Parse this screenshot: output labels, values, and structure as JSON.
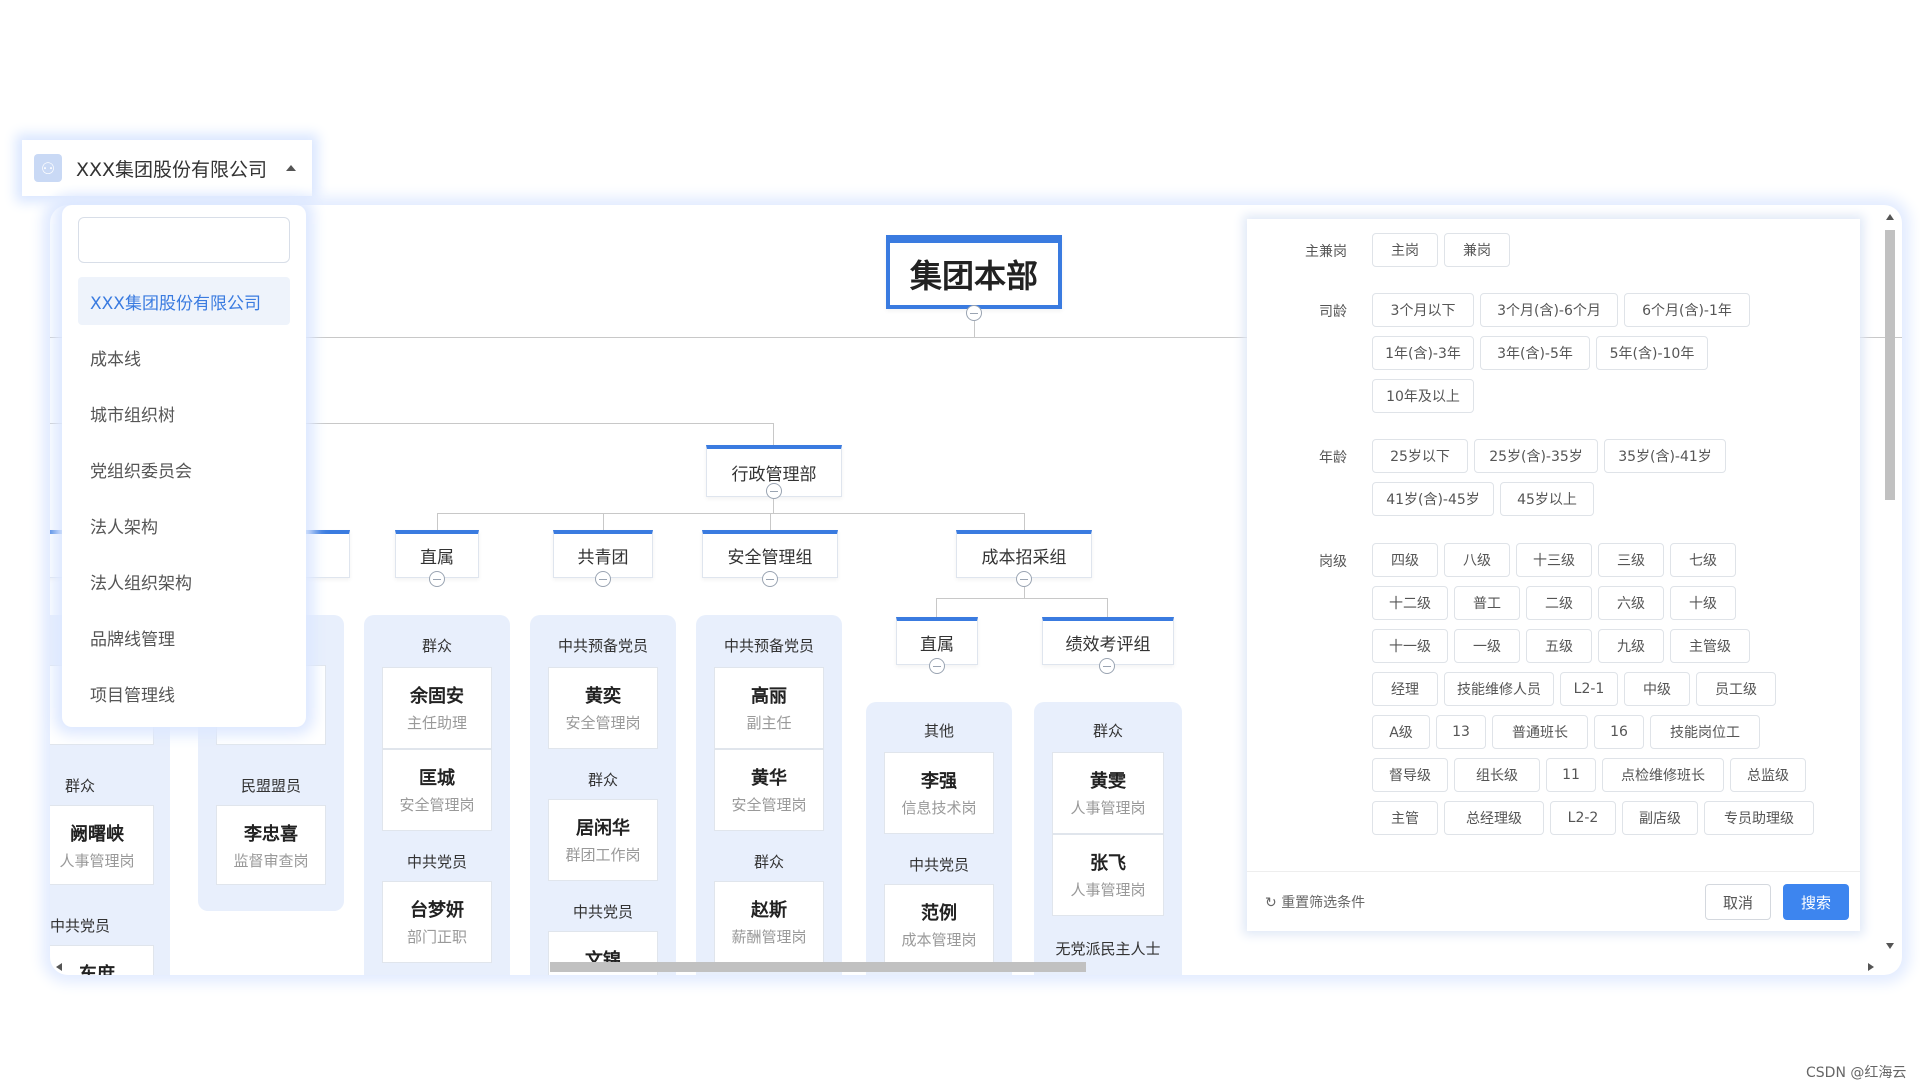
{
  "org_selector": {
    "icon": "org-tree-icon",
    "label": "XXX集团股份有限公司"
  },
  "dropdown": {
    "options": [
      "XXX集团股份有限公司",
      "成本线",
      "城市组织树",
      "党组织委员会",
      "法人架构",
      "法人组织架构",
      "品牌线管理",
      "项目管理线"
    ]
  },
  "tree": {
    "root": "集团本部",
    "level1": "行政管理部",
    "level2": [
      "直属",
      "共青团",
      "安全管理组",
      "成本招采组"
    ],
    "level3": [
      "直属",
      "绩效考评组"
    ],
    "columns": {
      "far_left": {
        "groups": [
          "群众",
          "中共党员"
        ],
        "cards": [
          {
            "name": "阙曙峡",
            "role": "人事管理岗"
          },
          {
            "name": "东庶",
            "role": ""
          }
        ]
      },
      "left2": {
        "groups": [
          "民盟盟员"
        ],
        "cards": [
          {
            "name": "李忠喜",
            "role": "监督审查岗"
          }
        ]
      },
      "zhishu": {
        "groups": [
          "群众",
          "中共党员"
        ],
        "cards": [
          {
            "name": "余固安",
            "role": "主任助理"
          },
          {
            "name": "匡城",
            "role": "安全管理岗"
          },
          {
            "name": "台梦妍",
            "role": "部门正职"
          }
        ]
      },
      "gongqingtuan": {
        "groups": [
          "中共预备党员",
          "群众",
          "中共党员"
        ],
        "cards": [
          {
            "name": "黄奕",
            "role": "安全管理岗"
          },
          {
            "name": "居闲华",
            "role": "群团工作岗"
          },
          {
            "name": "文锦",
            "role": ""
          }
        ]
      },
      "anquan": {
        "groups": [
          "中共预备党员",
          "群众"
        ],
        "cards": [
          {
            "name": "高丽",
            "role": "副主任"
          },
          {
            "name": "黄华",
            "role": "安全管理岗"
          },
          {
            "name": "赵斯",
            "role": "薪酬管理岗"
          }
        ]
      },
      "zhishu2": {
        "groups": [
          "其他",
          "中共党员"
        ],
        "cards": [
          {
            "name": "李强",
            "role": "信息技术岗"
          },
          {
            "name": "范例",
            "role": "成本管理岗"
          }
        ]
      },
      "jixiao": {
        "groups": [
          "群众",
          "无党派民主人士"
        ],
        "cards": [
          {
            "name": "黄雯",
            "role": "人事管理岗"
          },
          {
            "name": "张飞",
            "role": "人事管理岗"
          }
        ]
      }
    }
  },
  "filter": {
    "rows": [
      {
        "label": "主兼岗",
        "tags": [
          "主岗",
          "兼岗"
        ]
      },
      {
        "label": "司龄",
        "tags": [
          "3个月以下",
          "3个月(含)-6个月",
          "6个月(含)-1年",
          "1年(含)-3年",
          "3年(含)-5年",
          "5年(含)-10年",
          "10年及以上"
        ]
      },
      {
        "label": "年龄",
        "tags": [
          "25岁以下",
          "25岁(含)-35岁",
          "35岁(含)-41岁",
          "41岁(含)-45岁",
          "45岁以上"
        ]
      },
      {
        "label": "岗级",
        "tags": [
          "四级",
          "八级",
          "十三级",
          "三级",
          "七级",
          "十二级",
          "普工",
          "二级",
          "六级",
          "十级",
          "十一级",
          "一级",
          "五级",
          "九级",
          "主管级",
          "经理",
          "技能维修人员",
          "L2-1",
          "中级",
          "员工级",
          "A级",
          "13",
          "普通班长",
          "16",
          "技能岗位工",
          "督导级",
          "组长级",
          "11",
          "点检维修班长",
          "总监级",
          "主管",
          "总经理级",
          "L2-2",
          "副店级",
          "专员助理级"
        ]
      }
    ],
    "reset_label": "重置筛选条件",
    "cancel_label": "取消",
    "search_label": "搜索"
  },
  "watermark": "CSDN @红海云"
}
